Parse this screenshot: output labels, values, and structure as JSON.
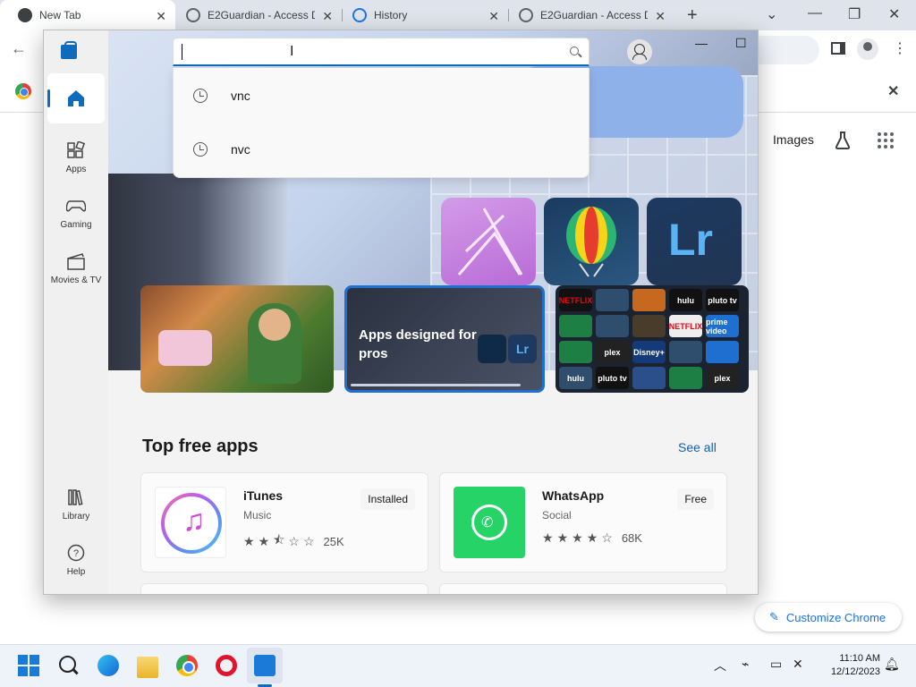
{
  "browser": {
    "tabs": [
      {
        "title": "New Tab",
        "active": true
      },
      {
        "title": "E2Guardian - Access D",
        "active": false
      },
      {
        "title": "History",
        "active": false
      },
      {
        "title": "E2Guardian - Access D",
        "active": false
      }
    ],
    "new_tab_symbol": "+",
    "ntp": {
      "images_link": "Images",
      "customize_label": "Customize Chrome"
    }
  },
  "store": {
    "search": {
      "value": "",
      "suggestions": [
        "vnc",
        "nvc"
      ]
    },
    "nav": [
      {
        "label": "",
        "icon": "home-icon"
      },
      {
        "label": "Apps",
        "icon": "apps-icon"
      },
      {
        "label": "Gaming",
        "icon": "gaming-icon"
      },
      {
        "label": "Movies & TV",
        "icon": "movies-icon"
      },
      {
        "label": "Library",
        "icon": "library-icon"
      },
      {
        "label": "Help",
        "icon": "help-icon"
      }
    ],
    "hero": {
      "tiles": [
        "Affinity",
        "CorelDRAW",
        "Lr"
      ],
      "cards": [
        {
          "title": ""
        },
        {
          "title": "Apps designed for pros",
          "mini_label": "Lr"
        },
        {
          "title": ""
        }
      ],
      "stream_logos": [
        "NETFLIX",
        "",
        "",
        "hulu",
        "pluto tv",
        "",
        "",
        "",
        "NETFLIX",
        "prime video",
        "",
        "plex",
        "Disney+",
        "",
        "",
        "hulu",
        "pluto tv",
        "",
        "",
        "plex"
      ]
    },
    "section": {
      "title": "Top free apps",
      "see_all": "See all"
    },
    "apps": [
      {
        "name": "iTunes",
        "category": "Music",
        "rating": 2.5,
        "reviews": "25K",
        "action": "Installed"
      },
      {
        "name": "WhatsApp",
        "category": "Social",
        "rating": 4,
        "reviews": "68K",
        "action": "Free"
      }
    ]
  },
  "taskbar": {
    "time": "11:10 AM",
    "date": "12/12/2023"
  }
}
